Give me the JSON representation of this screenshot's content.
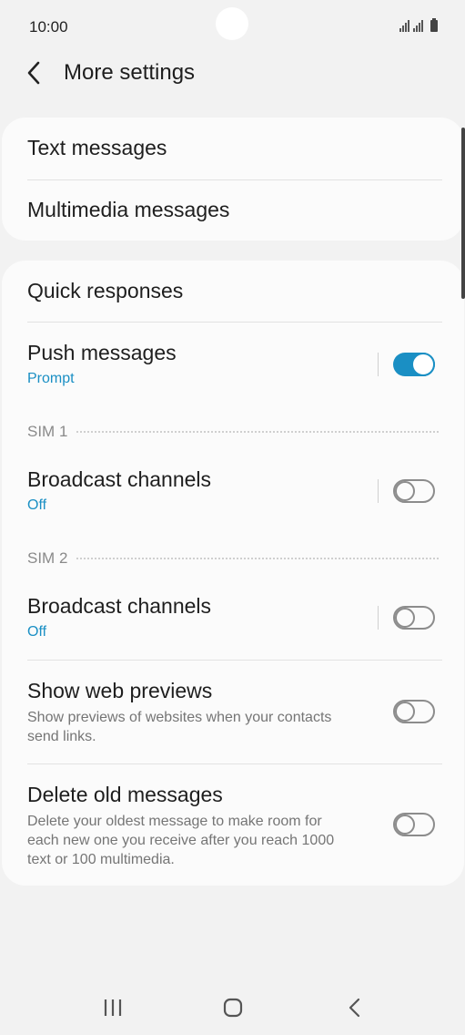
{
  "status_bar": {
    "time": "10:00"
  },
  "header": {
    "title": "More settings"
  },
  "card1": {
    "items": [
      {
        "title": "Text messages"
      },
      {
        "title": "Multimedia messages"
      }
    ]
  },
  "card2": {
    "quick_responses": {
      "title": "Quick responses"
    },
    "push_messages": {
      "title": "Push messages",
      "subtitle": "Prompt",
      "toggle_on": true
    },
    "sim1": {
      "label": "SIM 1",
      "title": "Broadcast channels",
      "subtitle": "Off",
      "toggle_on": false
    },
    "sim2": {
      "label": "SIM 2",
      "title": "Broadcast channels",
      "subtitle": "Off",
      "toggle_on": false
    },
    "web_previews": {
      "title": "Show web previews",
      "description": "Show previews of websites when your contacts send links.",
      "toggle_on": false
    },
    "delete_old": {
      "title": "Delete old messages",
      "description": "Delete your oldest message to make room for each new one you receive after you reach 1000 text or 100 multimedia.",
      "toggle_on": false
    }
  },
  "colors": {
    "accent": "#1a8fc4",
    "background": "#f2f2f2",
    "card": "#fbfbfb"
  },
  "icons": {
    "back": "back-arrow-icon",
    "signal": "signal-icon",
    "battery": "battery-icon",
    "recents": "recents-icon",
    "home": "home-icon",
    "nav_back": "nav-back-icon"
  }
}
